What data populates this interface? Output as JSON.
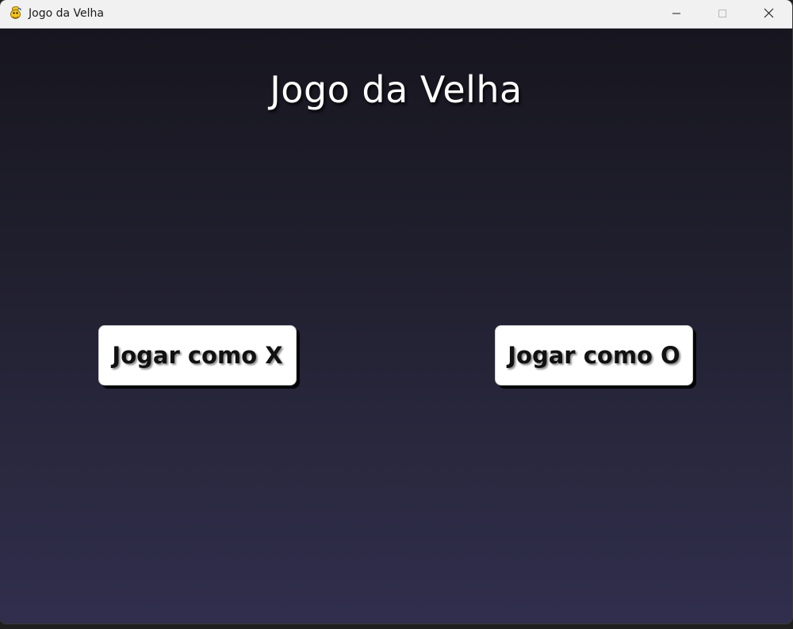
{
  "window": {
    "title": "Jogo da Velha",
    "icon": "python-snake-icon",
    "controls": {
      "minimize": "minimize-icon",
      "maximize": "maximize-icon",
      "close": "close-icon"
    }
  },
  "game": {
    "title": "Jogo da Velha",
    "buttons": {
      "play_x": "Jogar como X",
      "play_o": "Jogar como O"
    }
  },
  "colors": {
    "background_top": "#17161f",
    "background_bottom": "#302e4d",
    "button_bg": "#ffffff",
    "button_text": "#111111",
    "title_text": "#ffffff"
  }
}
